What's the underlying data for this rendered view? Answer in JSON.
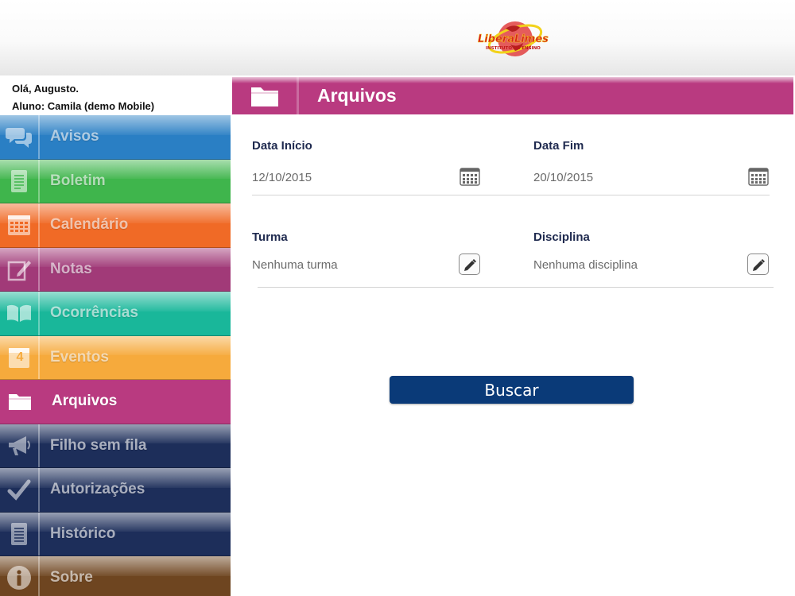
{
  "header": {
    "logo_text": "LiberaLimes",
    "logo_subtext": "INSTITUTO DE ENSINO"
  },
  "user": {
    "greeting": "Olá, Augusto.",
    "student": "Aluno: Camila (demo Mobile)"
  },
  "sidebar": {
    "items": [
      {
        "label": "Avisos",
        "icon": "chat-bubbles-icon",
        "color": "#2a7fc4"
      },
      {
        "label": "Boletim",
        "icon": "document-icon",
        "color": "#3fb54c"
      },
      {
        "label": "Calendário",
        "icon": "calendar-icon",
        "color": "#f06a26"
      },
      {
        "label": "Notas",
        "icon": "pencil-note-icon",
        "color": "#a13a78"
      },
      {
        "label": "Ocorrências",
        "icon": "open-book-icon",
        "color": "#19b79a"
      },
      {
        "label": "Eventos",
        "icon": "calendar-day-icon",
        "color": "#f6aa3c",
        "day": "4"
      },
      {
        "label": "Arquivos",
        "icon": "folder-icon",
        "color": "#b93a80",
        "active": true
      },
      {
        "label": "Filho sem fila",
        "icon": "megaphone-icon",
        "color": "#1d2e5a"
      },
      {
        "label": "Autorizações",
        "icon": "checkmark-icon",
        "color": "#1d2e5a"
      },
      {
        "label": "Histórico",
        "icon": "list-document-icon",
        "color": "#1d2e5a"
      },
      {
        "label": "Sobre",
        "icon": "info-icon",
        "color": "#6e4520"
      }
    ]
  },
  "page": {
    "title": "Arquivos",
    "color": "#b93a80",
    "data_inicio": {
      "label": "Data Início",
      "value": "12/10/2015"
    },
    "data_fim": {
      "label": "Data Fim",
      "value": "20/10/2015"
    },
    "turma": {
      "label": "Turma",
      "value": "Nenhuma turma"
    },
    "disciplina": {
      "label": "Disciplina",
      "value": "Nenhuma disciplina"
    },
    "search_button": "Buscar"
  }
}
